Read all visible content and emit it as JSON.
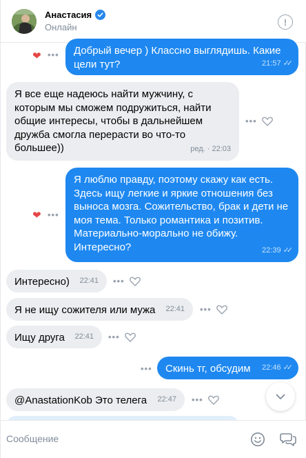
{
  "header": {
    "name": "Анастасия",
    "status": "Онлайн",
    "info_icon": "info-circle-icon",
    "verified_icon": "verified-check-icon"
  },
  "messages": [
    {
      "dir": "out",
      "text": "Добрый вечер ) Классно выглядишь. Какие цели тут?",
      "time": "21:57",
      "read": true,
      "liked": true
    },
    {
      "dir": "in",
      "text": "Я все еще надеюсь найти мужчину, с которым мы сможем подружиться, найти общие интересы, чтобы в дальнейшем дружба смогла перерасти во что-то большее))",
      "time": "ред. · 22:03"
    },
    {
      "dir": "out",
      "text": "Я люблю правду, поэтому скажу как есть. Здесь ищу легкие и яркие отношения без выноса мозга. Сожительство, брак и дети не моя тема. Только романтика и позитив. Материально-морально не обижу. Интересно?",
      "time": "22:39",
      "read": true,
      "liked": true
    },
    {
      "dir": "in",
      "text": "Интересно)",
      "time": "22:41"
    },
    {
      "dir": "in",
      "text": "Я не ищу сожителя или мужа",
      "time": "22:41"
    },
    {
      "dir": "in",
      "text": "Ищу друга",
      "time": "22:41"
    },
    {
      "dir": "out",
      "text": "Скинь тг, обсудим",
      "time": "22:46",
      "read": true
    },
    {
      "dir": "in",
      "text": "@AnastationKob Это телега",
      "time": "22:47"
    }
  ],
  "composer": {
    "placeholder": "Сообщение"
  },
  "colors": {
    "outgoing_bubble": "#1e88f0",
    "incoming_bubble": "#ebedf0",
    "like_red": "#e64646",
    "accent": "#2688eb"
  }
}
